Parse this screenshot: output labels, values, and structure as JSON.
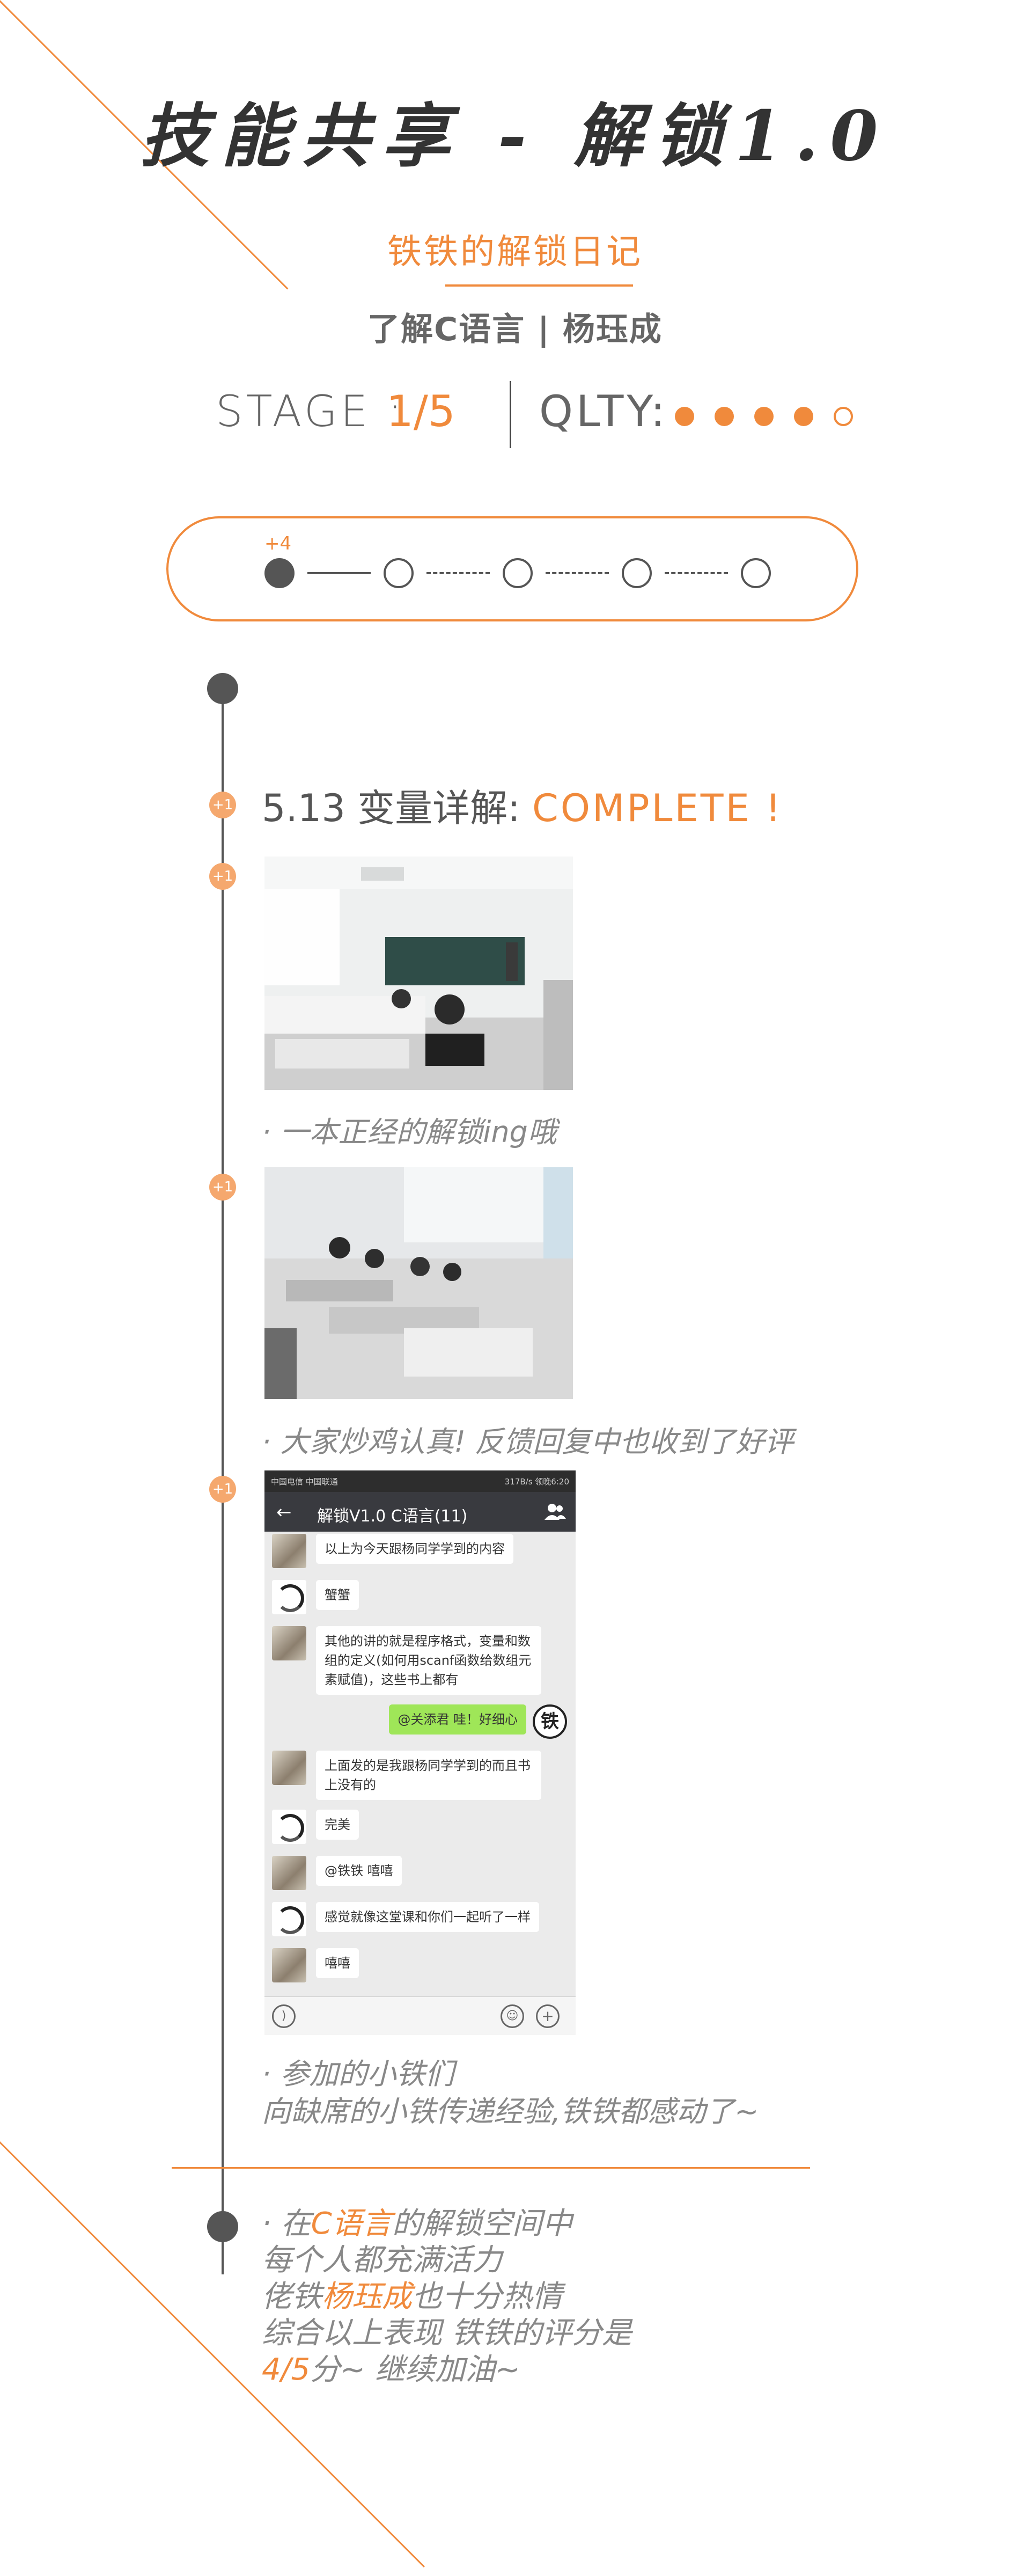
{
  "header": {
    "title": "技能共享 - 解锁1.0",
    "subtitle": "铁铁的解锁日记",
    "topic": "了解C语言 | 杨珏成"
  },
  "stage": {
    "label": "STAGE :",
    "value": "1/5",
    "quality_label": "QLTY:",
    "quality_filled": 4,
    "quality_total": 5
  },
  "progress": {
    "badge": "+4",
    "completed_nodes": 1,
    "total_nodes": 5
  },
  "timeline": {
    "plus_badge": "+1",
    "section": {
      "date_title": "5.13 变量详解:",
      "status": "COMPLETE !"
    },
    "captions": [
      "· 一本正经的解锁ing哦",
      "· 大家炒鸡认真!  反馈回复中也收到了好评",
      "· 参加的小铁们",
      "向缺席的小铁传递经验,铁铁都感动了~"
    ]
  },
  "chat": {
    "status_left": "中国电信 中国联通",
    "status_right": "317B/s  领晚6:20",
    "title": "解锁V1.0 C语言(11)",
    "messages": [
      {
        "side": "left",
        "avatar": "photo",
        "text": "以上为今天跟杨同学学到的内容"
      },
      {
        "side": "left",
        "avatar": "ring",
        "text": "蟹蟹"
      },
      {
        "side": "left",
        "avatar": "photo",
        "text": "其他的讲的就是程序格式，变量和数组的定义(如何用scanf函数给数组元素赋值)，这些书上都有"
      },
      {
        "side": "right",
        "avatar": "seal",
        "text": "@关添君 哇！好细心"
      },
      {
        "side": "left",
        "avatar": "photo",
        "text": "上面发的是我跟杨同学学到的而且书上没有的"
      },
      {
        "side": "left",
        "avatar": "ring",
        "text": "完美"
      },
      {
        "side": "left",
        "avatar": "photo",
        "text": "@铁铁 嘻嘻"
      },
      {
        "side": "left",
        "avatar": "ring",
        "text": "感觉就像这堂课和你们一起听了一样"
      },
      {
        "side": "left",
        "avatar": "photo",
        "text": "嘻嘻"
      }
    ],
    "seal_char": "铁"
  },
  "summary": {
    "line1_pre": "· 在",
    "line1_hl": "C语言",
    "line1_post": "的解锁空间中",
    "line2": "每个人都充满活力",
    "line3_pre": "佬铁",
    "line3_hl": "杨珏成",
    "line3_post": "也十分热情",
    "line4": "综合以上表现 铁铁的评分是",
    "line5_hl": "4/5",
    "line5_post": "分~ 继续加油~"
  },
  "colors": {
    "accent": "#f08a3c",
    "dark": "#555555",
    "chat_bg": "#ebebeb",
    "chat_header": "#393a3f",
    "bubble_green": "#9fe658"
  }
}
